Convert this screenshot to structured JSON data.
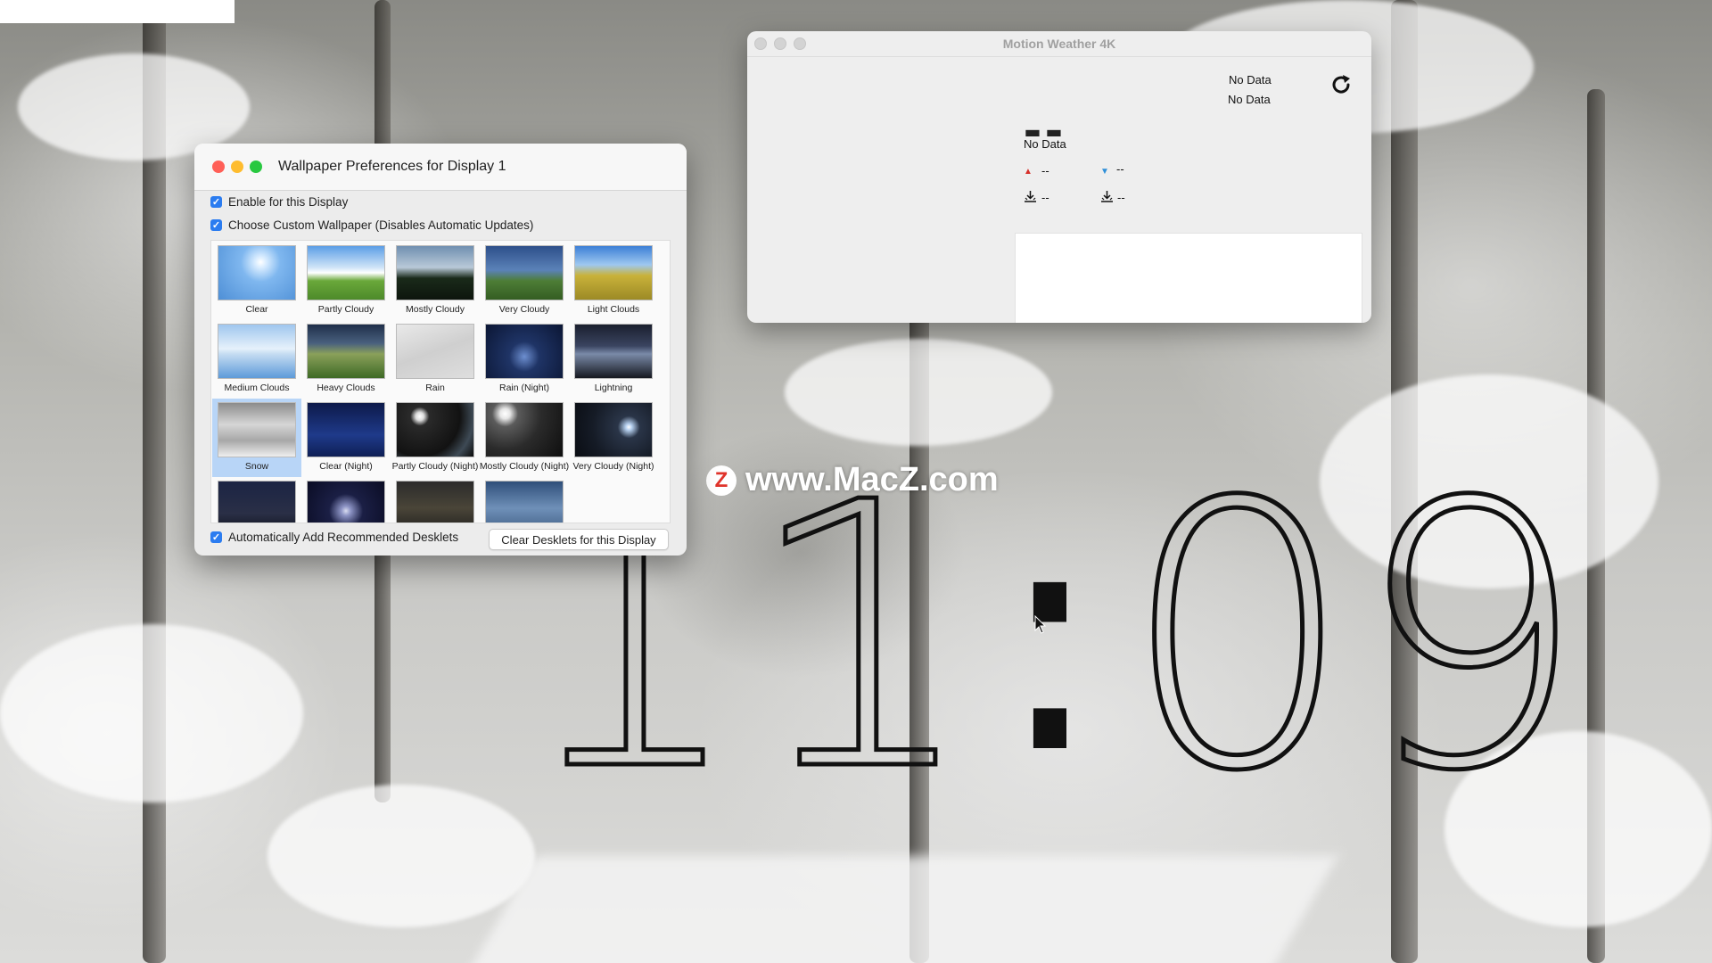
{
  "weather_window": {
    "title": "Motion Weather 4K",
    "status_line_1": "No Data",
    "status_line_2": "No Data",
    "temperature": "--",
    "condition": "No Data",
    "high": "--",
    "low": "--",
    "sunrise": "--",
    "sunset": "--"
  },
  "prefs_window": {
    "title": "Wallpaper Preferences for Display 1",
    "enable_label": "Enable for this Display",
    "enable_checked": true,
    "custom_label": "Choose Custom Wallpaper (Disables Automatic Updates)",
    "custom_checked": true,
    "wallpapers": [
      {
        "label": "Clear",
        "selected": false
      },
      {
        "label": "Partly Cloudy",
        "selected": false
      },
      {
        "label": "Mostly Cloudy",
        "selected": false
      },
      {
        "label": "Very Cloudy",
        "selected": false
      },
      {
        "label": "Light Clouds",
        "selected": false
      },
      {
        "label": "Medium Clouds",
        "selected": false
      },
      {
        "label": "Heavy Clouds",
        "selected": false
      },
      {
        "label": "Rain",
        "selected": false
      },
      {
        "label": "Rain (Night)",
        "selected": false
      },
      {
        "label": "Lightning",
        "selected": false
      },
      {
        "label": "Snow",
        "selected": true
      },
      {
        "label": "Clear (Night)",
        "selected": false
      },
      {
        "label": "Partly Cloudy (Night)",
        "selected": false
      },
      {
        "label": "Mostly Cloudy (Night)",
        "selected": false
      },
      {
        "label": "Very Cloudy (Night)",
        "selected": false
      }
    ],
    "auto_add_label": "Automatically Add Recommended Desklets",
    "auto_add_checked": true,
    "clear_button": "Clear Desklets for this Display"
  },
  "clock": {
    "hour_1": "1",
    "hour_2": "1",
    "separator": ":",
    "minute_1": "0",
    "minute_2": "9"
  },
  "watermark": {
    "logo_letter": "Z",
    "text": "www.MacZ.com"
  },
  "colors": {
    "accent": "#2b7cf0",
    "selection": "#b8d5f7",
    "close": "#ff5f57",
    "minimize": "#febc2e",
    "zoom": "#28c840"
  }
}
